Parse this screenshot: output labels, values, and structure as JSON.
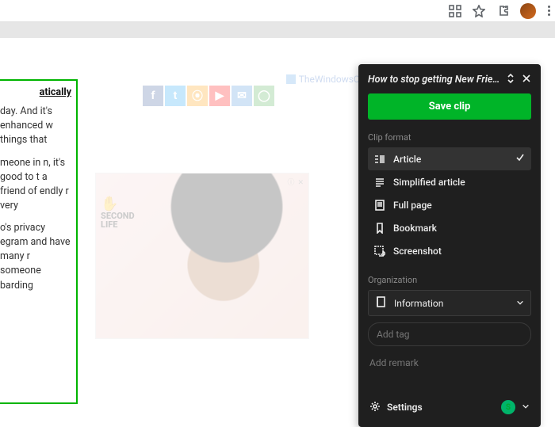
{
  "browser": {
    "icons": [
      "qr-icon",
      "star-icon",
      "puzzle-icon",
      "avatar",
      "kebab-icon"
    ]
  },
  "page": {
    "watermark": "TheWindowsClub",
    "article": {
      "heading": "atically",
      "p1": "day. And it's enhanced w things that",
      "p2": "meone in n, it's good to t a friend of endly r very",
      "p3": "o's privacy egram and have many r someone barding"
    },
    "socials": [
      {
        "glyph": "f",
        "bg": "#3b5998"
      },
      {
        "glyph": "t",
        "bg": "#1da1f2"
      },
      {
        "glyph": "⦿",
        "bg": "#ff9900"
      },
      {
        "glyph": "▶",
        "bg": "#ff0000"
      },
      {
        "glyph": "✉",
        "bg": "#4a90d9"
      },
      {
        "glyph": "◯",
        "bg": "#4caf50"
      }
    ],
    "ad": {
      "label": "ⓘ",
      "close": "✕",
      "brand_top": "SECOND",
      "brand_bottom": "LIFE"
    }
  },
  "clipper": {
    "title": "How to stop getting New Friend",
    "save_label": "Save clip",
    "clip_format_label": "Clip format",
    "formats": [
      {
        "id": "article",
        "label": "Article",
        "selected": true
      },
      {
        "id": "simplified",
        "label": "Simplified article",
        "selected": false
      },
      {
        "id": "fullpage",
        "label": "Full page",
        "selected": false
      },
      {
        "id": "bookmark",
        "label": "Bookmark",
        "selected": false
      },
      {
        "id": "screenshot",
        "label": "Screenshot",
        "selected": false
      }
    ],
    "organization_label": "Organization",
    "notebook": "Information",
    "add_tag_placeholder": "Add tag",
    "add_remark_label": "Add remark",
    "settings_label": "Settings",
    "account_badge": "S"
  }
}
